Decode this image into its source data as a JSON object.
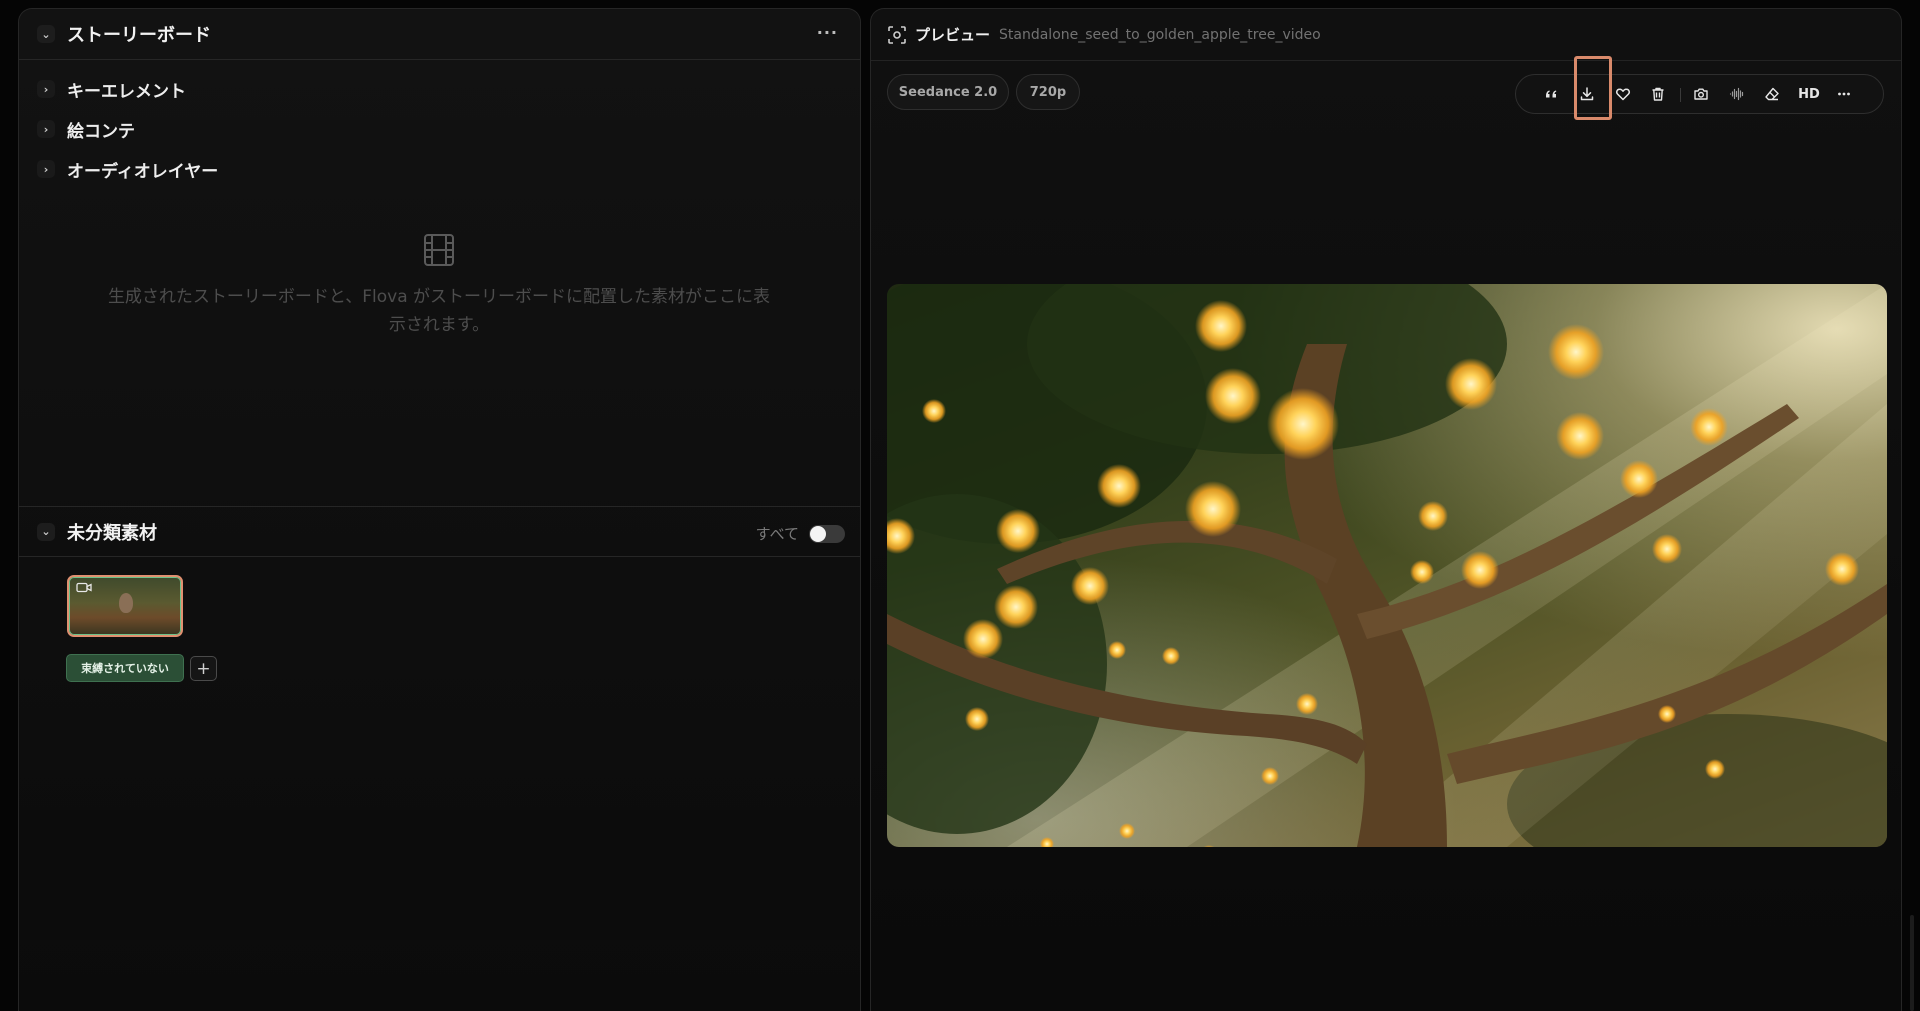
{
  "storyboard": {
    "title": "ストーリーボード",
    "menu": "···",
    "items": [
      {
        "label": "キーエレメント"
      },
      {
        "label": "絵コンテ"
      },
      {
        "label": "オーディオレイヤー"
      }
    ],
    "empty_line1": "生成されたストーリーボードと、Flova がストーリーボードに配置した素材がここに表",
    "empty_line2": "示されます。"
  },
  "uncategorized": {
    "title": "未分類素材",
    "toggle_label": "すべて",
    "toggle_on": false,
    "bind_label": "束縛されていない",
    "add_label": "+"
  },
  "preview": {
    "title": "プレビュー",
    "filename": "Standalone_seed_to_golden_apple_tree_video",
    "model_chip": "Seedance 2.0",
    "resolution_chip": "720p",
    "toolbar": {
      "quote_icon": "quote-icon",
      "download_icon": "download-icon",
      "favorite_icon": "heart-icon",
      "delete_icon": "trash-icon",
      "snapshot_icon": "camera-icon",
      "audio_icon": "waveform-icon",
      "erase_icon": "eraser-icon",
      "hd_label": "HD",
      "more_icon": "more-icon"
    }
  },
  "colors": {
    "highlight": "#d98a6b",
    "bind_badge": "#2b4f36",
    "thumb_border": "#e09070"
  }
}
